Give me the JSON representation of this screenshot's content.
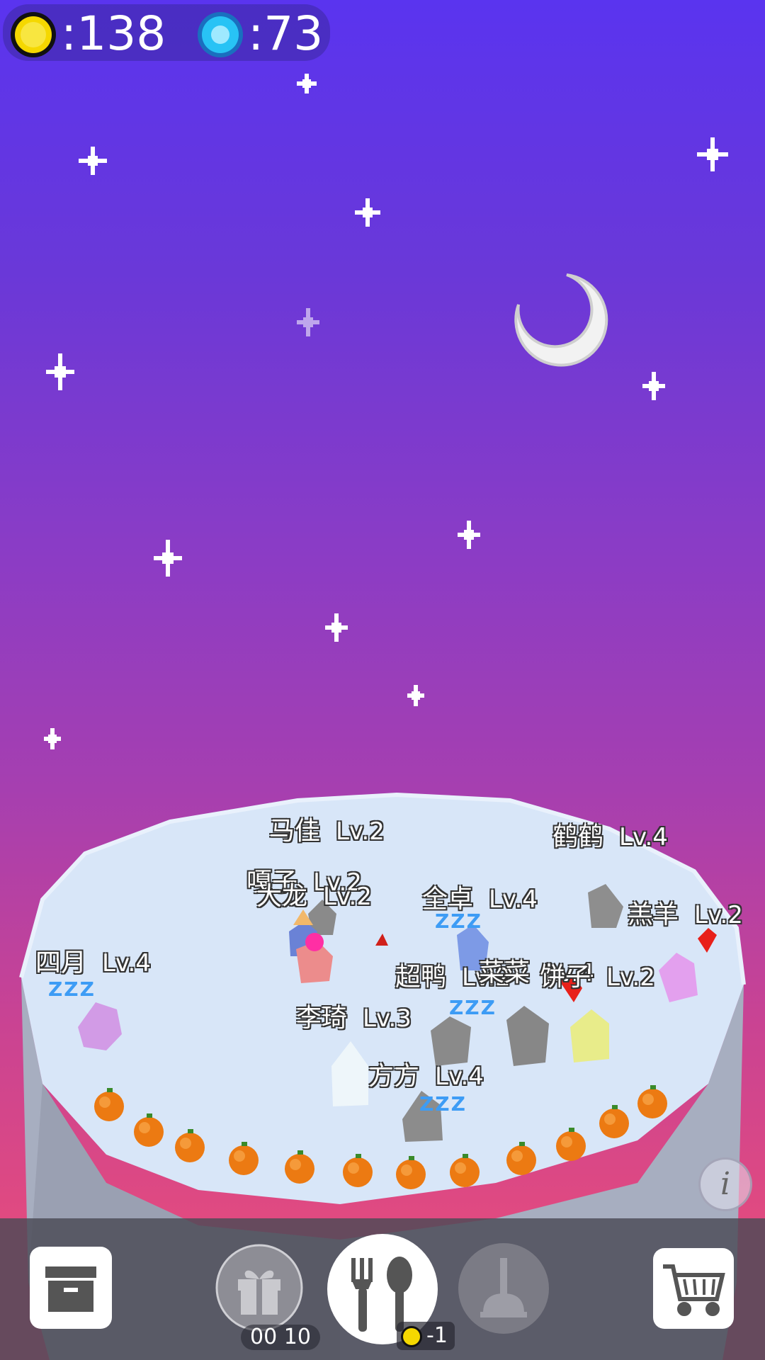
{
  "hud": {
    "coins": ":138",
    "gems": ":73",
    "coin_icon": "coin-icon",
    "gem_icon": "gem-icon"
  },
  "pets": [
    {
      "name": "马佳",
      "level": "Lv.2"
    },
    {
      "name": "鹤鹤",
      "level": "Lv.4"
    },
    {
      "name": "嘎子",
      "level": "Lv.2"
    },
    {
      "name": "大龙",
      "level": "Lv.2"
    },
    {
      "name": "全卓",
      "level": "Lv.4"
    },
    {
      "name": "羔羊",
      "level": "Lv.2"
    },
    {
      "name": "四月",
      "level": "Lv.4"
    },
    {
      "name": "超鸭",
      "level": "Lv.2"
    },
    {
      "name": "菜菜",
      "level": "Lv.4"
    },
    {
      "name": "饼子",
      "level": "Lv.2"
    },
    {
      "name": "李琦",
      "level": "Lv.3"
    },
    {
      "name": "方方",
      "level": "Lv.4"
    }
  ],
  "sleep_text": "ZZZ",
  "toolbar": {
    "timer": "00 10",
    "feed_cost": "-1",
    "info_label": "i",
    "icons": [
      "box-icon",
      "gift-icon",
      "fork-spoon-icon",
      "plunger-icon",
      "cart-icon"
    ]
  }
}
